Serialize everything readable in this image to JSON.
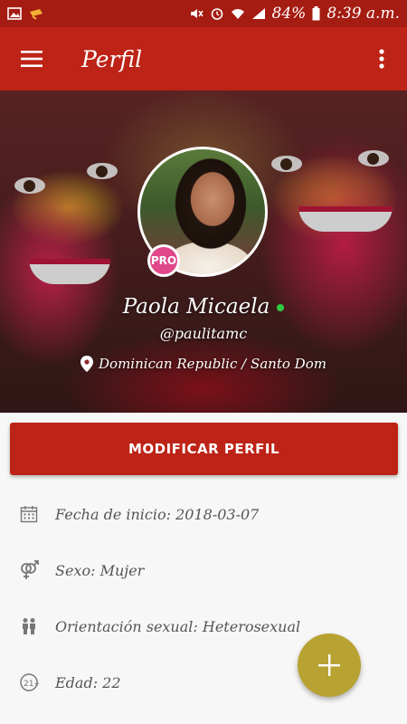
{
  "status_bar": {
    "battery": "84%",
    "time": "8:39 a.m."
  },
  "app_bar": {
    "title": "Perfil"
  },
  "profile": {
    "name": "Paola Micaela",
    "handle": "@paulitamc",
    "location": "Dominican Republic / Santo Dom",
    "badge": "PRO",
    "online": true
  },
  "actions": {
    "edit_label": "MODIFICAR PERFIL"
  },
  "details": [
    {
      "icon": "calendar-icon",
      "text": "Fecha de inicio: 2018-03-07"
    },
    {
      "icon": "gender-icon",
      "text": "Sexo: Mujer"
    },
    {
      "icon": "people-icon",
      "text": "Orientación sexual: Heterosexual"
    },
    {
      "icon": "age-21-icon",
      "text": "Edad: 22"
    }
  ],
  "colors": {
    "primary": "#bd2316",
    "status_bar": "#a51c12",
    "fab": "#b8a232",
    "pro_badge": "#e0488a",
    "online": "#2ecc40"
  }
}
